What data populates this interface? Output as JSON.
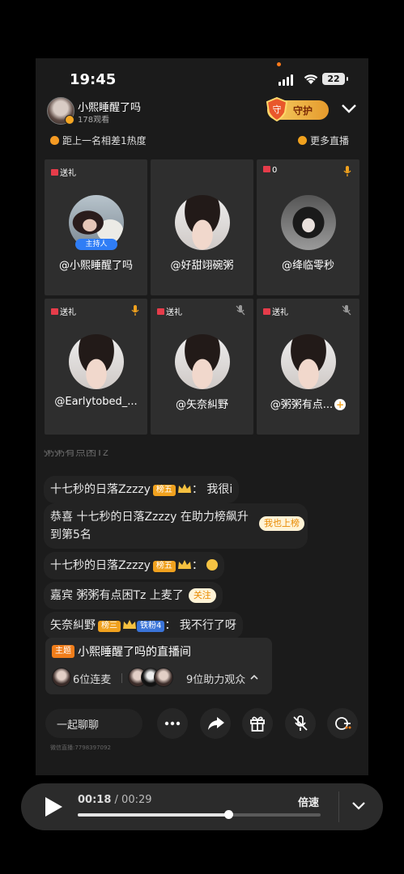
{
  "status_bar": {
    "time": "19:45",
    "battery": "22"
  },
  "host": {
    "name": "小熙睡醒了吗",
    "viewers": "178观看",
    "guard_label": "守护",
    "guard_icon": "shield-icon"
  },
  "info_bar": {
    "hot_gap": "距上一名相差1热度",
    "more_live": "更多直播"
  },
  "tiles": [
    {
      "gift": "送礼",
      "name": "@小熙睡醒了吗",
      "host_tag": "主持人"
    },
    {
      "gift": "",
      "name": "@好甜翊碗粥"
    },
    {
      "gift": "0",
      "name": "@绛临零秒",
      "mic": "mic-icon"
    },
    {
      "gift": "送礼",
      "name": "@Earlytobed_...",
      "mic": "mic-icon"
    },
    {
      "gift": "送礼",
      "name": "@矢奈糾野",
      "mic": "mic-muted-icon"
    },
    {
      "gift": "送礼",
      "name": "@粥粥有点...",
      "mic": "mic-muted-icon",
      "plus": "+"
    }
  ],
  "comments": {
    "faded": "粥粥有点困Tz",
    "c1": {
      "user": "十七秒的日落Zzzzy",
      "badge": "榜五",
      "colon": "：",
      "text": "我很i"
    },
    "c2": {
      "line1": "恭喜 十七秒的日落Zzzzy 在助力榜飙升",
      "line2": "到第5名",
      "action": "我也上榜"
    },
    "c3": {
      "user": "十七秒的日落Zzzzy",
      "badge": "榜五",
      "colon": "："
    },
    "c4": {
      "text": "嘉宾 粥粥有点困Tz 上麦了",
      "action": "关注"
    },
    "c5": {
      "user": "矢奈糾野",
      "badge": "榜三",
      "fan": "铁粉4",
      "colon": "：",
      "text": "我不行了呀"
    }
  },
  "room_card": {
    "tag": "主题",
    "title": "小熙睡醒了吗的直播间",
    "left": "6位连麦",
    "right": "9位助力观众"
  },
  "bottom_bar": {
    "chat_placeholder": "一起聊聊",
    "watermark": "微信直播:7798397092"
  },
  "player": {
    "current": "00:18",
    "separator": " / ",
    "total": "00:29",
    "speed": "倍速",
    "progress": 0.62
  },
  "colors": {
    "accent": "#f5a623",
    "background": "#1b1b1b",
    "host_tag": "#2f7df6"
  }
}
